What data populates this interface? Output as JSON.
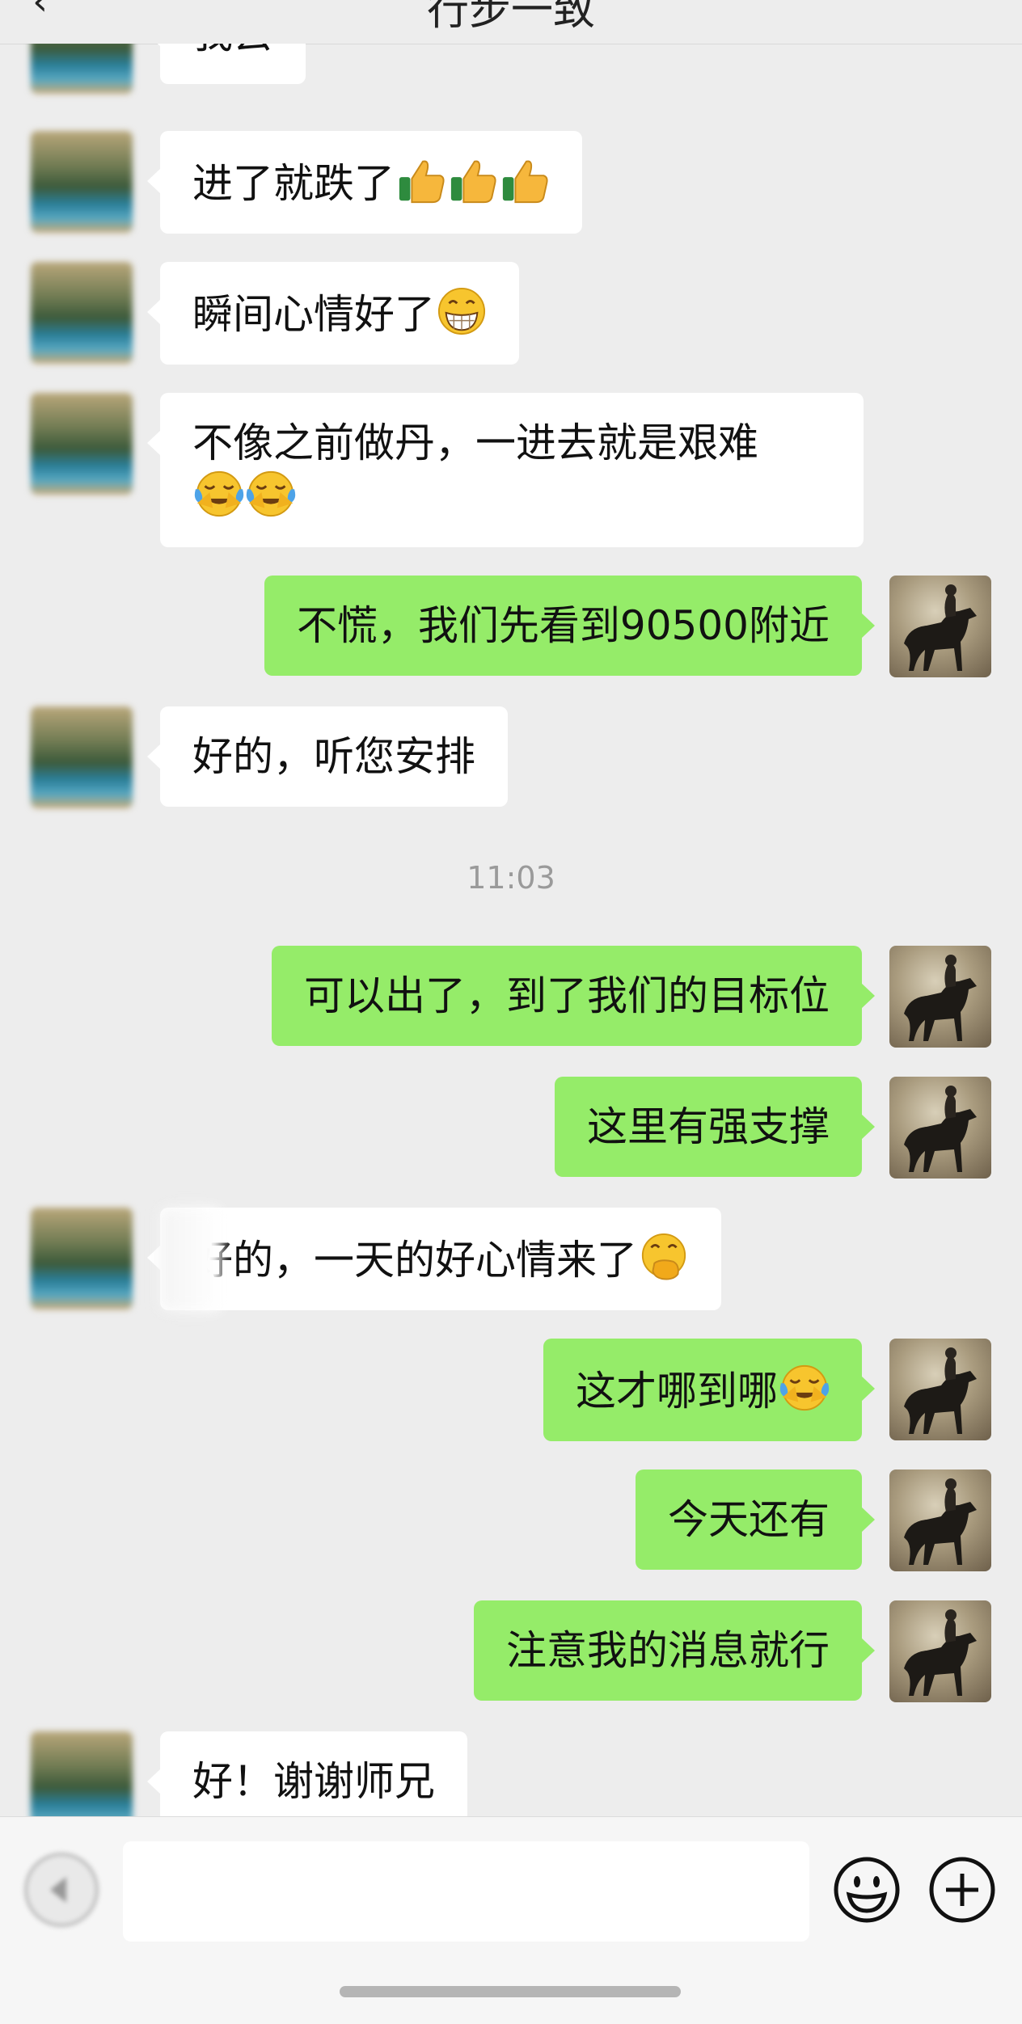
{
  "header": {
    "back_icon": "back-arrow-icon",
    "title": "行步一致"
  },
  "colors": {
    "background": "#ededed",
    "incoming_bubble": "#ffffff",
    "outgoing_bubble": "#95ec69",
    "timestamp_text": "#9a9a9a"
  },
  "messages": [
    {
      "dir": "in",
      "text": "我去"
    },
    {
      "dir": "in",
      "text": "进了就跌了",
      "emoji": [
        "thumbs-up-icon",
        "thumbs-up-icon",
        "thumbs-up-icon"
      ]
    },
    {
      "dir": "in",
      "text": "瞬间心情好了",
      "emoji": [
        "grinning-face-icon"
      ]
    },
    {
      "dir": "in",
      "text": "不像之前做丹，一进去就是艰难",
      "emoji": [
        "tears-of-joy-icon",
        "tears-of-joy-icon"
      ]
    },
    {
      "dir": "out",
      "text": "不慌，我们先看到90500附近"
    },
    {
      "dir": "in",
      "text": "好的，听您安排"
    },
    {
      "dir": "out",
      "text": "可以出了，到了我们的目标位"
    },
    {
      "dir": "out",
      "text": "这里有强支撑"
    },
    {
      "dir": "in",
      "text": "好的，一天的好心情来了",
      "emoji": [
        "hand-over-mouth-icon"
      ]
    },
    {
      "dir": "out",
      "text": "这才哪到哪",
      "emoji": [
        "tears-of-joy-icon"
      ]
    },
    {
      "dir": "out",
      "text": "今天还有"
    },
    {
      "dir": "out",
      "text": "注意我的消息就行"
    },
    {
      "dir": "in",
      "text": "好！谢谢师兄"
    }
  ],
  "timestamp": "11:03",
  "input_bar": {
    "voice_icon": "voice-input-icon",
    "text_value": "",
    "emoji_icon": "smiley-face-icon",
    "plus_icon": "plus-icon"
  }
}
